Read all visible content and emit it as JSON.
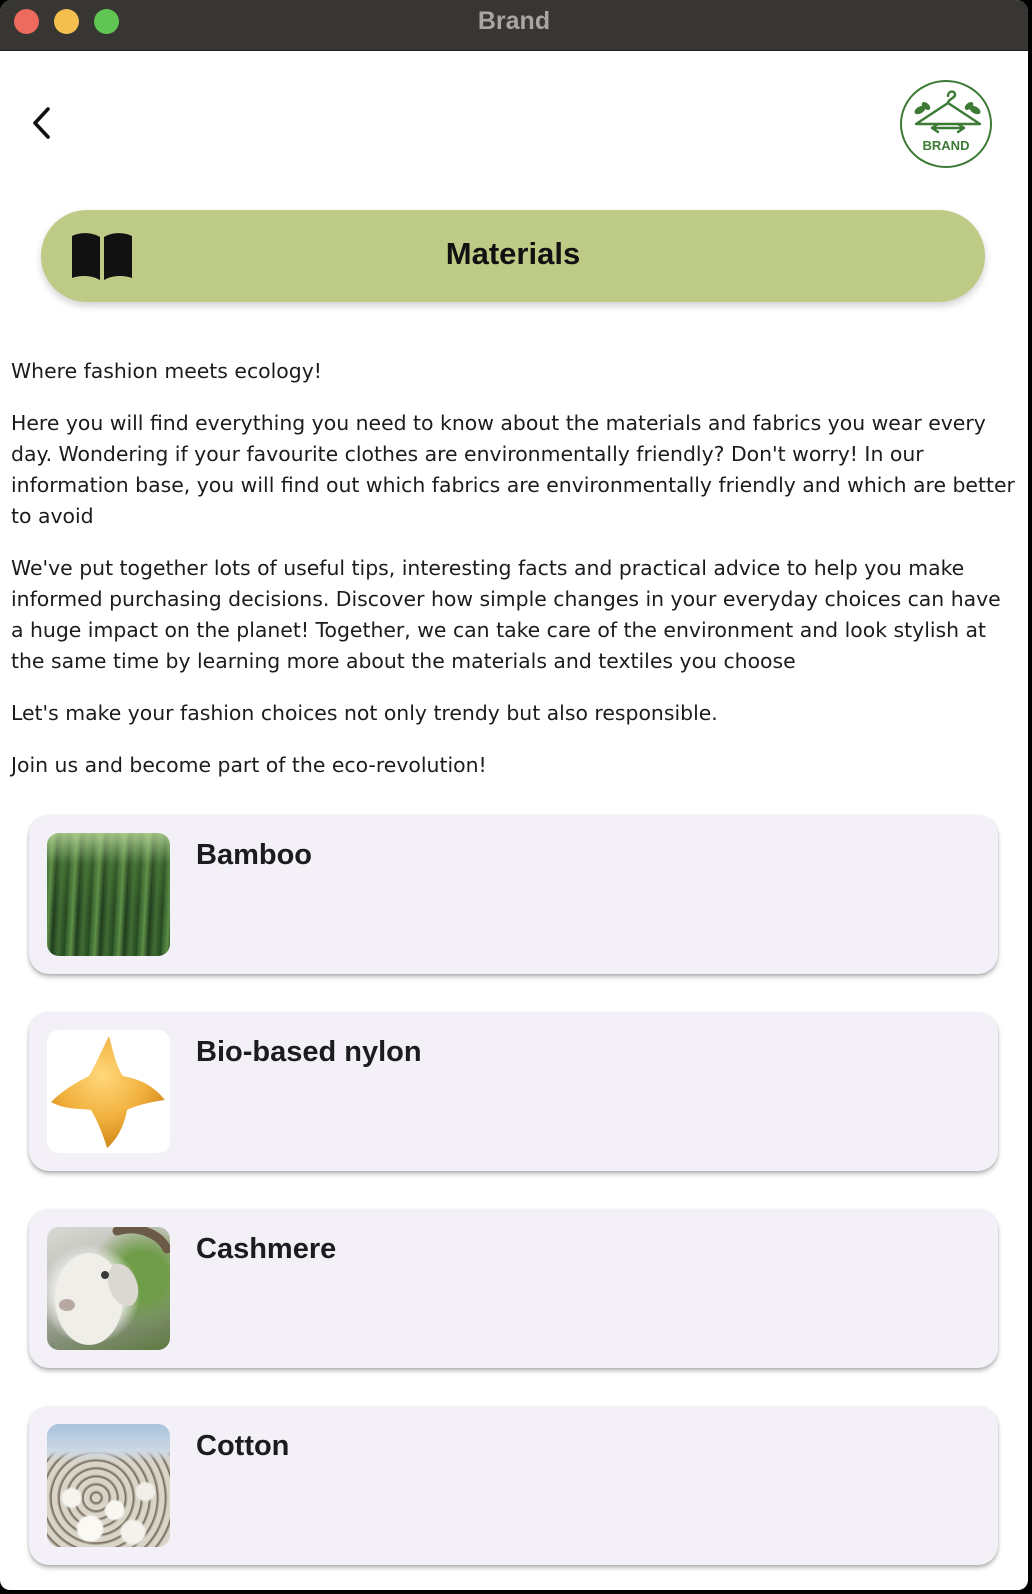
{
  "window": {
    "title": "Brand"
  },
  "nav": {
    "back_icon": "chevron-left-icon",
    "logo_text": "BRAND",
    "logo_color": "#3c7a35"
  },
  "header": {
    "icon": "open-book-icon",
    "title": "Materials",
    "background": "#bdcb86"
  },
  "intro": {
    "paragraphs": [
      "Where fashion meets ecology!",
      "Here you will find everything you need to know about the materials and fabrics you wear every day. Wondering if your favourite clothes are environmentally friendly? Don't worry! In our information base, you will find out which fabrics are environmentally friendly and which are better to avoid",
      "We've put together lots of useful tips, interesting facts and practical advice to help you make informed purchasing decisions. Discover how simple changes in your everyday choices can have a huge impact on the planet! Together, we can take care of the environment and look stylish at the same time by learning more about the materials and textiles you choose",
      "Let's make your fashion choices not only trendy but also responsible.",
      "Join us and become part of the eco-revolution!"
    ]
  },
  "materials": [
    {
      "name": "Bamboo",
      "image": "bamboo-forest-photo"
    },
    {
      "name": "Bio-based nylon",
      "image": "gold-star-icon"
    },
    {
      "name": "Cashmere",
      "image": "goat-photo"
    },
    {
      "name": "Cotton",
      "image": "cotton-field-photo"
    }
  ]
}
